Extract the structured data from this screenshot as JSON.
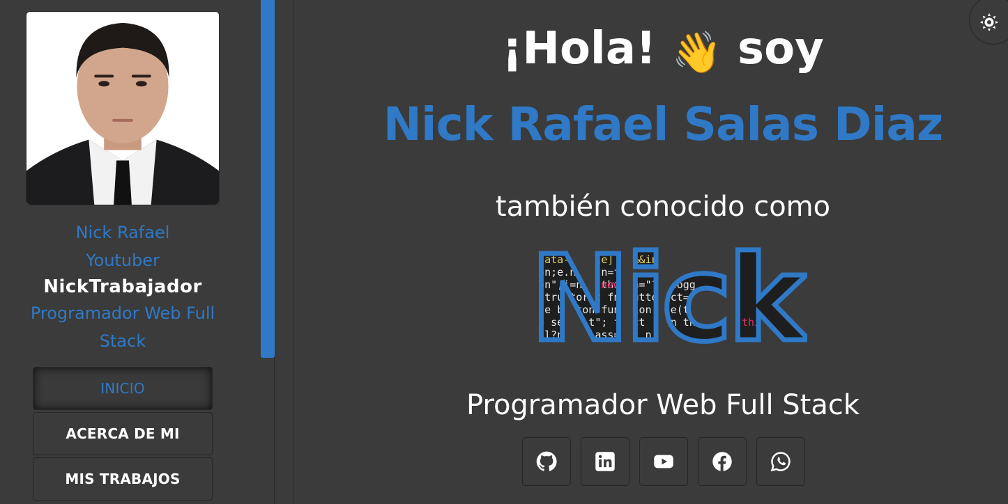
{
  "profile": {
    "name": "Nick Rafael",
    "youtube": "Youtuber",
    "channel": "NickTrabajador",
    "role": "Programador Web Full Stack"
  },
  "nav": {
    "items": [
      {
        "label": "INICIO",
        "active": true
      },
      {
        "label": "ACERCA DE MI",
        "active": false
      },
      {
        "label": "MIS TRABAJOS",
        "active": false
      }
    ]
  },
  "hero": {
    "greeting": "¡Hola!",
    "greeting_suffix": "soy",
    "full_name": "Nick Rafael Salas Diaz",
    "aka": "también conocido como",
    "nickname": "Nick",
    "role": "Programador Web Full Stack"
  },
  "socials": [
    {
      "icon": "github-icon"
    },
    {
      "icon": "linkedin-icon"
    },
    {
      "icon": "youtube-icon"
    },
    {
      "icon": "facebook-icon"
    },
    {
      "icon": "whatsapp-icon"
    }
  ],
  "colors": {
    "accent": "#2f79c6",
    "background": "#3b3b3b",
    "text": "#ffffff"
  },
  "theme_toggle": {
    "icon": "sun-icon"
  }
}
